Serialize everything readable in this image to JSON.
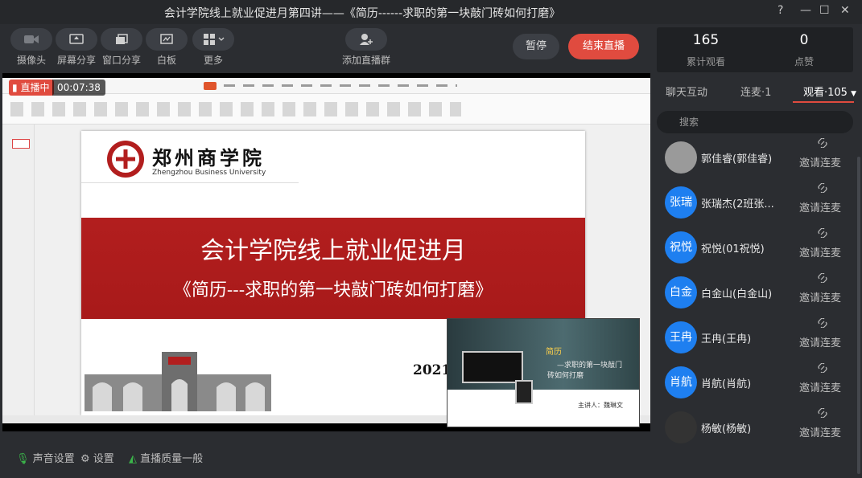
{
  "window": {
    "title": "会计学院线上就业促进月第四讲——《简历------求职的第一块敲门砖如何打磨》"
  },
  "toolbar": {
    "camera": "摄像头",
    "screen_share": "屏幕分享",
    "window_share": "窗口分享",
    "whiteboard": "白板",
    "more": "更多",
    "add_group": "添加直播群",
    "pause": "暂停",
    "end_live": "结束直播"
  },
  "stage": {
    "live_label": "直播中",
    "live_time": "00:07:38",
    "slide": {
      "school_name": "郑州商学院",
      "school_en": "Zhengzhou Business University",
      "heading": "会计学院线上就业促进月",
      "subheading": "《简历---求职的第一块敲门砖如何打磨》",
      "year": "2021"
    },
    "pip": {
      "title": "简历",
      "line1": "—求职的第一块敲门",
      "line2": "砖如何打磨",
      "speaker": "主讲人：魏琳文"
    }
  },
  "bottom": {
    "audio": "声音设置",
    "settings": "设置",
    "quality": "直播质量一般"
  },
  "stats": {
    "views": "165",
    "views_label": "累计观看",
    "likes": "0",
    "likes_label": "点赞"
  },
  "tabs": {
    "chat": "聊天互动",
    "mic": "连麦·1",
    "viewers": "观看·105"
  },
  "search": {
    "placeholder": "搜索"
  },
  "viewers": [
    {
      "avatar": "",
      "name": "郭佳睿(郭佳睿)",
      "invite": "邀请连麦",
      "color": "#9a9a9a"
    },
    {
      "avatar": "张瑞",
      "name": "张瑞杰(2班张...",
      "invite": "邀请连麦",
      "color": "#1e7ff0"
    },
    {
      "avatar": "祝悦",
      "name": "祝悦(01祝悦)",
      "invite": "邀请连麦",
      "color": "#1e7ff0"
    },
    {
      "avatar": "白金",
      "name": "白金山(白金山)",
      "invite": "邀请连麦",
      "color": "#1e7ff0"
    },
    {
      "avatar": "王冉",
      "name": "王冉(王冉)",
      "invite": "邀请连麦",
      "color": "#1e7ff0"
    },
    {
      "avatar": "肖航",
      "name": "肖航(肖航)",
      "invite": "邀请连麦",
      "color": "#1e7ff0"
    },
    {
      "avatar": "",
      "name": "杨敏(杨敏)",
      "invite": "邀请连麦",
      "color": "#333"
    }
  ],
  "colors": {
    "accent": "#e04b3f",
    "avatar_blue": "#1e7ff0",
    "banner_red": "#b21e1e"
  }
}
